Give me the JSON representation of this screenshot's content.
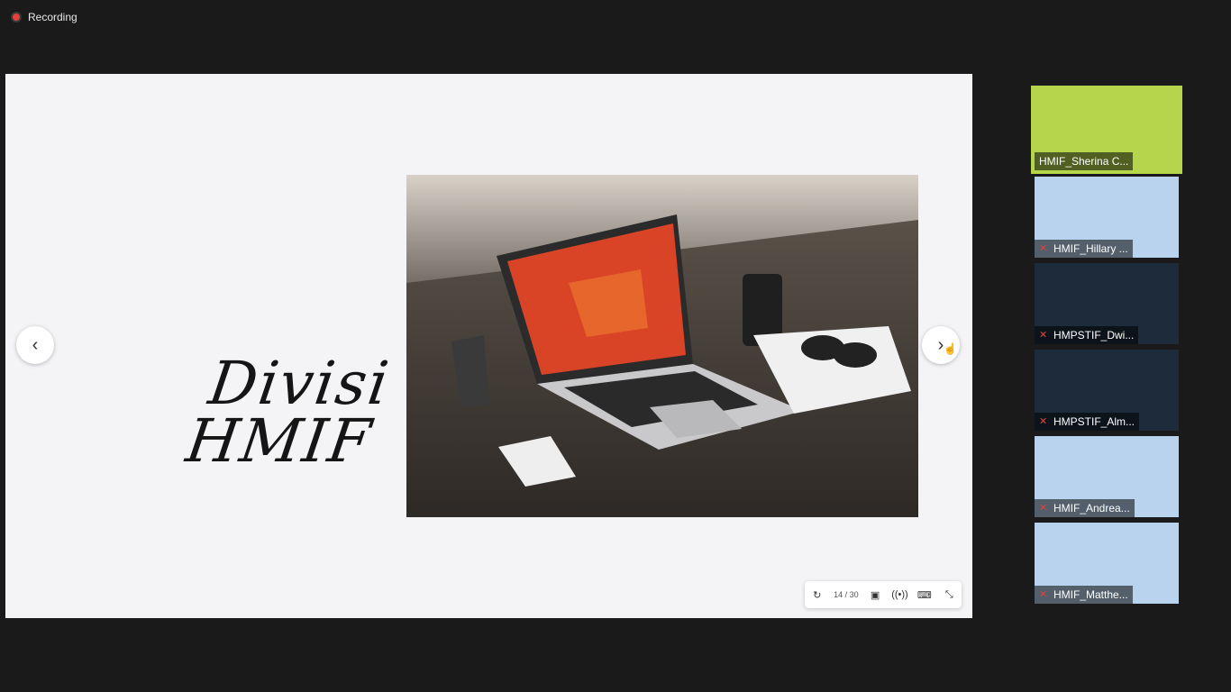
{
  "recording": {
    "label": "Recording"
  },
  "slide": {
    "title_line1": "Divisi",
    "title_line2": "HMIF"
  },
  "navigation": {
    "prev_icon": "chevron-left-icon",
    "next_icon": "chevron-right-icon"
  },
  "toolbar": {
    "page_indicator": "14 / 30",
    "icons": [
      "rotate-icon",
      "picture-in-picture-icon",
      "broadcast-icon",
      "keyboard-icon",
      "exit-fullscreen-icon"
    ]
  },
  "participants": [
    {
      "name": "HMIF_Sherina C...",
      "muted": false,
      "active": true
    },
    {
      "name": "HMIF_Hillary ...",
      "muted": true,
      "active": false
    },
    {
      "name": "HMPSTIF_Dwi...",
      "muted": true,
      "active": false
    },
    {
      "name": "HMPSTIF_Alm...",
      "muted": true,
      "active": false
    },
    {
      "name": "HMIF_Andrea...",
      "muted": true,
      "active": false
    },
    {
      "name": "HMIF_Matthe...",
      "muted": true,
      "active": false
    }
  ],
  "colors": {
    "background": "#1a1a1a",
    "recording": "#e0413c",
    "active_speaker": "#b4d54c",
    "slide_bg": "#f4f3f6"
  }
}
